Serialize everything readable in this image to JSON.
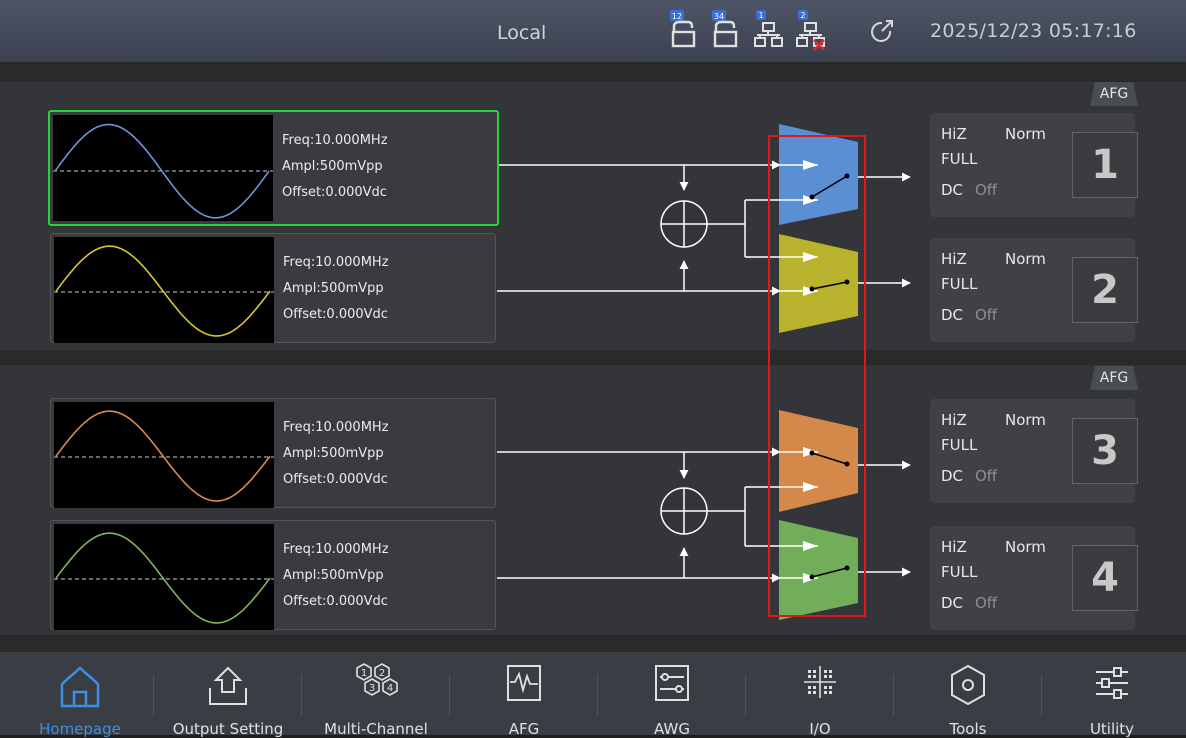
{
  "status_bar": {
    "mode": "Local",
    "datetime": "2025/12/23 05:17:16",
    "icons": [
      "lock-12-icon",
      "lock-34-icon",
      "network-1-icon",
      "network-2-disconnected-icon",
      "sync-icon"
    ],
    "icon_badges": {
      "lock_a": "12",
      "lock_b": "34",
      "net_a": "1",
      "net_b": "2"
    }
  },
  "groups": [
    {
      "tag": "AFG"
    },
    {
      "tag": "AFG"
    }
  ],
  "channels": [
    {
      "freq": "Freq:10.000MHz",
      "ampl": "Ampl:500mVpp",
      "offset": "Offset:0.000Vdc",
      "wave_color": "#6f95d6",
      "mux_color": "#5b8fd4",
      "hiz": "HiZ",
      "norm": "Norm",
      "full": "FULL",
      "dc": "DC",
      "off": "Off",
      "number": "1"
    },
    {
      "freq": "Freq:10.000MHz",
      "ampl": "Ampl:500mVpp",
      "offset": "Offset:0.000Vdc",
      "wave_color": "#d8c630",
      "mux_color": "#b8b22c",
      "hiz": "HiZ",
      "norm": "Norm",
      "full": "FULL",
      "dc": "DC",
      "off": "Off",
      "number": "2"
    },
    {
      "freq": "Freq:10.000MHz",
      "ampl": "Ampl:500mVpp",
      "offset": "Offset:0.000Vdc",
      "wave_color": "#d98b4a",
      "mux_color": "#d4884a",
      "hiz": "HiZ",
      "norm": "Norm",
      "full": "FULL",
      "dc": "DC",
      "off": "Off",
      "number": "3"
    },
    {
      "freq": "Freq:10.000MHz",
      "ampl": "Ampl:500mVpp",
      "offset": "Offset:0.000Vdc",
      "wave_color": "#7fb560",
      "mux_color": "#72ad5a",
      "hiz": "HiZ",
      "norm": "Norm",
      "full": "FULL",
      "dc": "DC",
      "off": "Off",
      "number": "4"
    }
  ],
  "nav": [
    {
      "label": "Homepage",
      "icon": "home-icon",
      "active": true
    },
    {
      "label": "Output Setting",
      "icon": "output-icon"
    },
    {
      "label": "Multi-Channel",
      "icon": "multi-channel-icon"
    },
    {
      "label": "AFG",
      "icon": "afg-icon"
    },
    {
      "label": "AWG",
      "icon": "awg-icon"
    },
    {
      "label": "I/O",
      "icon": "io-icon"
    },
    {
      "label": "Tools",
      "icon": "tools-icon"
    },
    {
      "label": "Utility",
      "icon": "utility-icon"
    }
  ],
  "colors": {
    "selected_border": "#26d43a",
    "active_nav": "#3a8fe6",
    "highlight_box": "#e01818"
  }
}
